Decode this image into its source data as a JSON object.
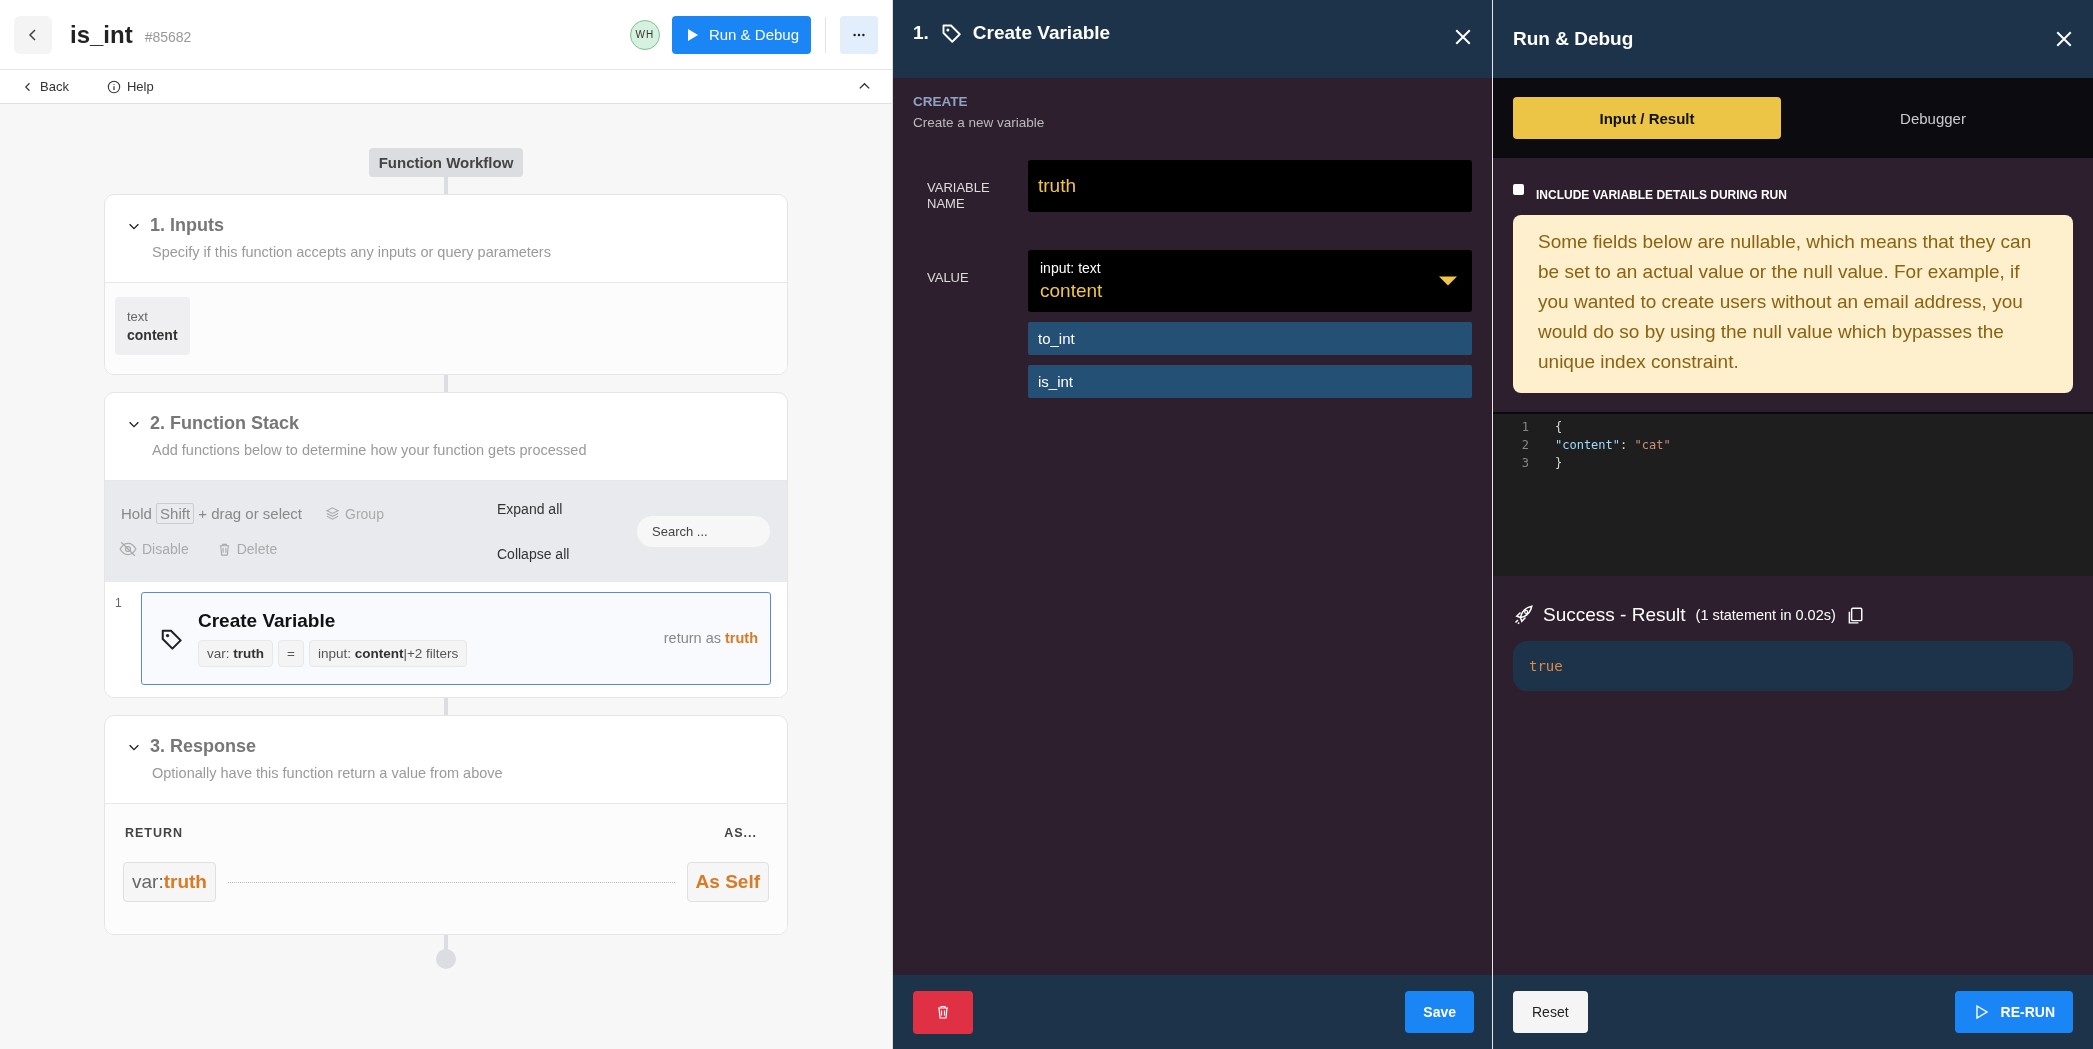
{
  "header": {
    "title": "is_int",
    "id": "#85682",
    "avatar": "WH",
    "run_button": "Run & Debug"
  },
  "subbar": {
    "back": "Back",
    "help": "Help"
  },
  "workflow": {
    "label": "Function Workflow",
    "sections": [
      {
        "kind": "inputs",
        "title": "1. Inputs",
        "description": "Specify if this function accepts any inputs or query parameters",
        "expanded": true,
        "inputs": [
          {
            "type": "text",
            "name": "content"
          }
        ]
      },
      {
        "kind": "stack",
        "title": "2. Function Stack",
        "description": "Add functions below to determine how your function gets processed",
        "expanded": true,
        "toolbar": {
          "hold": "Hold",
          "key": "Shift",
          "hint": "+ drag or select",
          "group": "Group",
          "disable": "Disable",
          "delete": "Delete",
          "expand_all": "Expand all",
          "collapse_all": "Collapse all",
          "search_placeholder": "Search ..."
        },
        "steps": [
          {
            "number": "1",
            "title": "Create Variable",
            "target": "var: **truth**",
            "operator": "=",
            "source": "input: **content**|+2 filters",
            "return_label": "return as",
            "return_value": "truth",
            "selected": true
          }
        ]
      },
      {
        "kind": "response",
        "title": "3. Response",
        "description": "Optionally have this function return a value from above",
        "expanded": true,
        "return_label": "RETURN",
        "as_label": "AS...",
        "return_prefix": "var:",
        "return_value": "truth",
        "as_value": "As Self"
      }
    ]
  },
  "variable_panel": {
    "number": "1.",
    "title": "Create Variable",
    "section": "CREATE",
    "description": "Create a new variable",
    "fields": [
      {
        "kind": "text",
        "label": "VARIABLE NAME",
        "value": "truth"
      },
      {
        "kind": "select",
        "label": "VALUE",
        "type_label": "input: text",
        "value": "content",
        "filters": [
          "to_int",
          "is_int"
        ]
      }
    ],
    "save": "Save"
  },
  "debug_panel": {
    "title": "Run & Debug",
    "tabs": [
      {
        "label": "Input / Result",
        "selected": true
      },
      {
        "label": "Debugger",
        "selected": false
      }
    ],
    "include_details": {
      "label": "INCLUDE VARIABLE DETAILS DURING RUN",
      "checked": false
    },
    "notice": "Some fields below are nullable, which means that they can be set to an actual value or the null value. For example, if you wanted to create users without an email address, you would do so by using the null value which bypasses the unique index constraint.",
    "code_lines": [
      {
        "number": "1",
        "tokens": [
          {
            "kind": "punct",
            "text": "{"
          }
        ]
      },
      {
        "number": "2",
        "tokens": [
          {
            "kind": "key",
            "text": "\"content\""
          },
          {
            "kind": "punct",
            "text": ": "
          },
          {
            "kind": "string",
            "text": "\"cat\""
          }
        ]
      },
      {
        "number": "3",
        "tokens": [
          {
            "kind": "punct",
            "text": "}"
          }
        ]
      }
    ],
    "result": {
      "title": "Success - Result",
      "detail": "(1 statement in 0.02s)",
      "value": "true"
    },
    "reset": "Reset",
    "rerun": "RE-RUN"
  }
}
